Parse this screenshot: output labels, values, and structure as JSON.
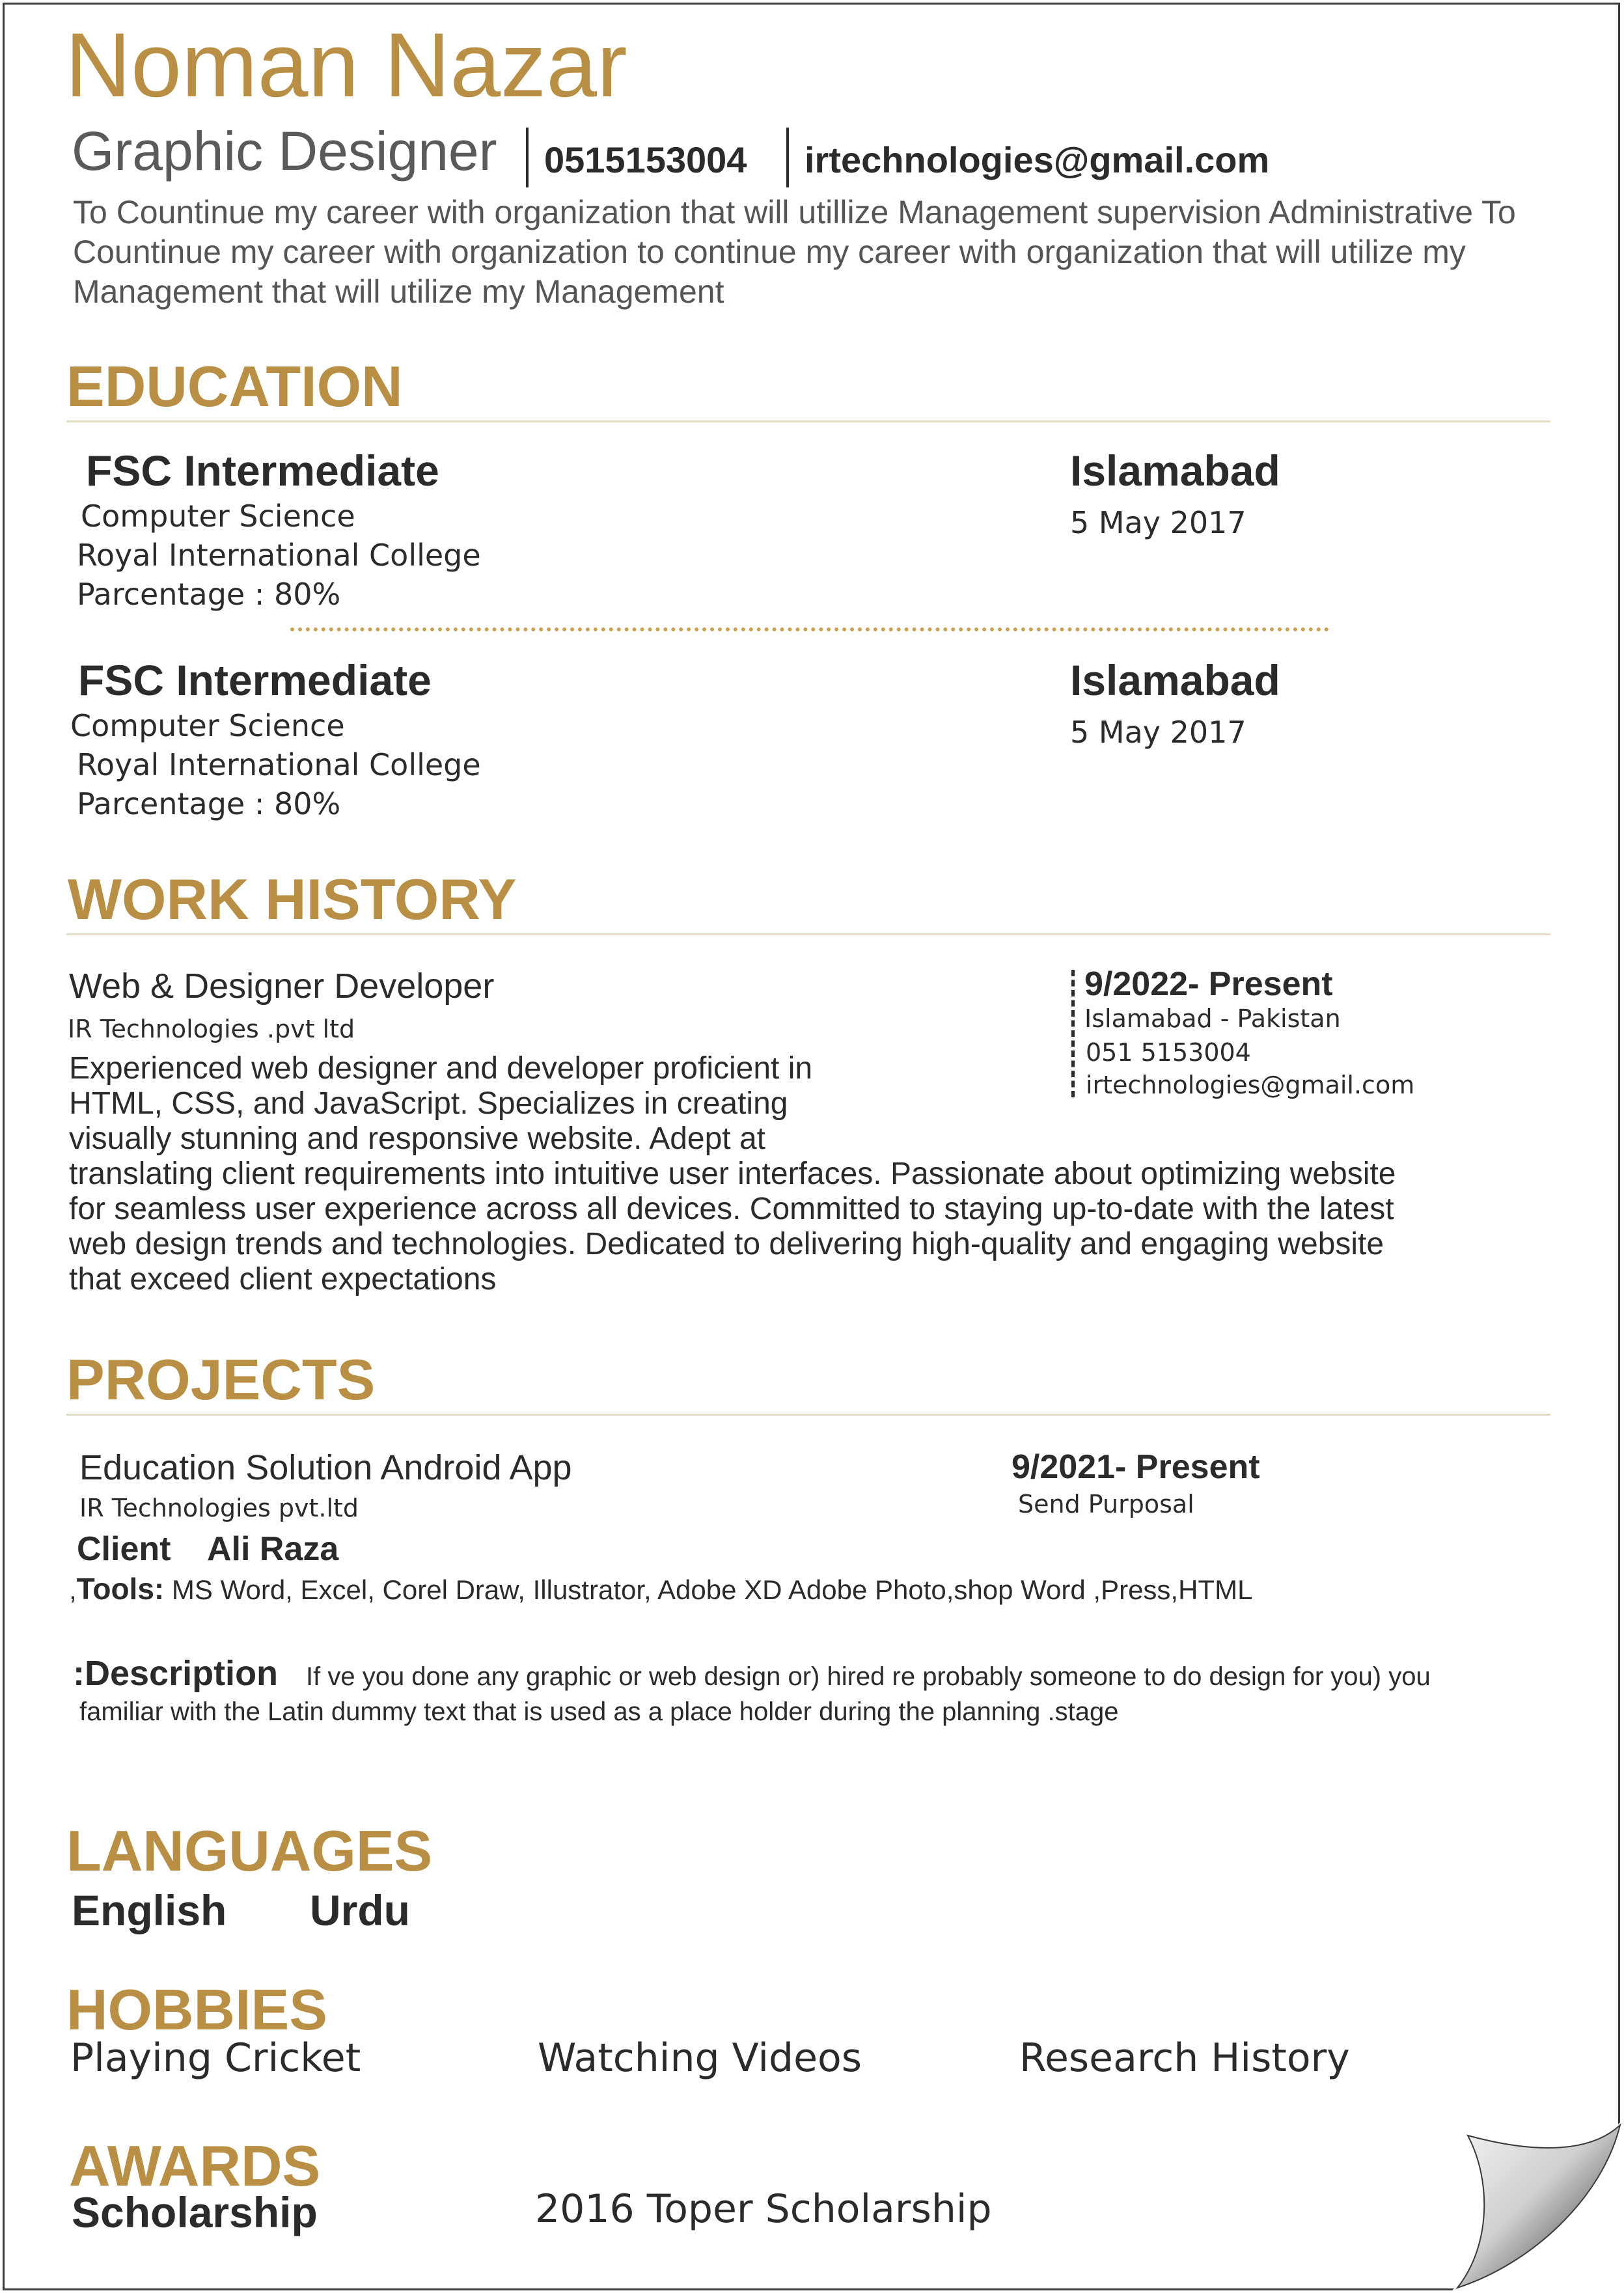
{
  "colors": {
    "accent": "#b88f45",
    "text": "#2b2b2b",
    "muted": "#5a5a5a"
  },
  "header": {
    "name": "Noman Nazar",
    "title": "Graphic Designer",
    "phone": "0515153004",
    "email": "irtechnologies@gmail.com",
    "summary": "To Countinue my career with organization that will utillize Management supervision Administrative To Countinue my career with organization to continue my career with organization that will utilize my Management that will utilize my Management"
  },
  "education": {
    "heading": "EDUCATION",
    "items": [
      {
        "degree": "FSC Intermediate",
        "field": "Computer Science",
        "school": "Royal International College",
        "grade": "Parcentage : 80%",
        "city": "Islamabad",
        "date": "5 May 2017"
      },
      {
        "degree": "FSC Intermediate",
        "field": "Computer Science",
        "school": "Royal International College",
        "grade": "Parcentage : 80%",
        "city": "Islamabad",
        "date": "5 May 2017"
      }
    ]
  },
  "work": {
    "heading": "WORK HISTORY",
    "role": "Web & Designer  Developer",
    "company": "IR Technologies  .pvt ltd",
    "date": "9/2022- Present",
    "location": "Islamabad - Pakistan",
    "phone": "051 5153004",
    "email": "irtechnologies@gmail.com",
    "desc_lines": [
      "Experienced web designer and developer proficient in",
      "HTML, CSS, and JavaScript. Specializes in creating",
      "visually stunning and responsive website. Adept at",
      "translating client requirements into intuitive user interfaces. Passionate about optimizing website",
      "for seamless user experience across all devices. Committed to staying up-to-date with the latest",
      "web design trends and technologies. Dedicated to delivering high-quality and engaging website",
      "that exceed client expectations"
    ]
  },
  "projects": {
    "heading": "PROJECTS",
    "name": "Education  Solution Android App",
    "company": "IR Technologies  pvt.ltd",
    "date": "9/2021- Present",
    "status": "Send Purposal",
    "client_label": "Client",
    "client_name": "Ali Raza",
    "tools_prefix": ",",
    "tools_label": "Tools:",
    "tools_value": "MS Word, Excel, Corel Draw, Illustrator, Adobe XD",
    "tools_extra": "Adobe  Photo,shop  Word  ,Press,HTML",
    "desc_label": ":Description",
    "desc_line1": "If ve you done any graphic or web design or)   hired  re probably someone to do design for you) you",
    "desc_line2": "familiar with the Latin dummy  text that is used as a place holder during the planning  .stage"
  },
  "languages": {
    "heading": "LANGUAGES",
    "items": [
      "English",
      "Urdu"
    ]
  },
  "hobbies": {
    "heading": "HOBBIES",
    "items": [
      "Playing Cricket",
      "Watching Videos",
      "Research History"
    ]
  },
  "awards": {
    "heading": "AWARDS",
    "label": "Scholarship",
    "value": "2016 Toper Scholarship"
  }
}
